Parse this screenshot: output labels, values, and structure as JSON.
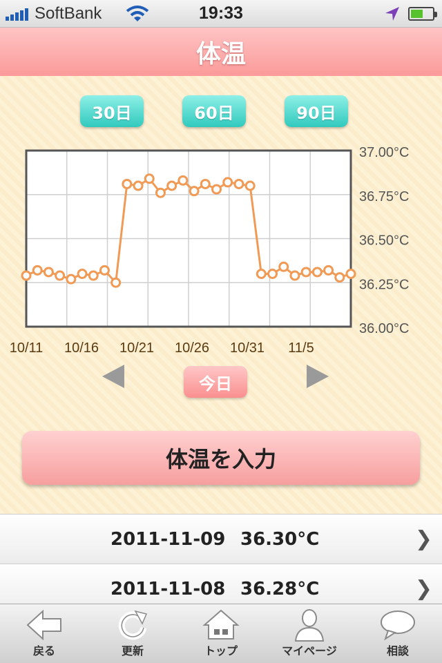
{
  "status_bar": {
    "carrier": "SoftBank",
    "time": "19:33"
  },
  "nav": {
    "title": "体温"
  },
  "ranges": [
    {
      "label": "30日"
    },
    {
      "label": "60日"
    },
    {
      "label": "90日"
    }
  ],
  "chart_data": {
    "type": "line",
    "ylim": [
      36.0,
      37.0
    ],
    "yticks": [
      "37.00°C",
      "36.75°C",
      "36.50°C",
      "36.25°C",
      "36.00°C"
    ],
    "xticks": [
      "10/11",
      "10/16",
      "10/21",
      "10/26",
      "10/31",
      "11/5"
    ],
    "x": [
      "10/11",
      "10/12",
      "10/13",
      "10/14",
      "10/15",
      "10/16",
      "10/17",
      "10/18",
      "10/19",
      "10/20",
      "10/21",
      "10/22",
      "10/23",
      "10/24",
      "10/25",
      "10/26",
      "10/27",
      "10/28",
      "10/29",
      "10/30",
      "10/31",
      "11/1",
      "11/2",
      "11/3",
      "11/4",
      "11/5",
      "11/6",
      "11/7",
      "11/8",
      "11/9"
    ],
    "series": [
      {
        "values": [
          36.29,
          36.32,
          36.31,
          36.29,
          36.27,
          36.3,
          36.29,
          36.32,
          36.25,
          36.81,
          36.8,
          36.84,
          36.76,
          36.8,
          36.83,
          36.77,
          36.81,
          36.78,
          36.82,
          36.81,
          36.8,
          36.3,
          36.3,
          36.34,
          36.29,
          36.31,
          36.31,
          36.32,
          36.28,
          36.3
        ]
      }
    ],
    "color": "#f09a55",
    "grid": true
  },
  "today_label": "今日",
  "input_button": "体温を入力",
  "records": [
    {
      "date": "2011-11-09",
      "temp": "36.30°C"
    },
    {
      "date": "2011-11-08",
      "temp": "36.28°C"
    }
  ],
  "tabs": [
    {
      "label": "戻る",
      "icon": "back-arrow-icon"
    },
    {
      "label": "更新",
      "icon": "refresh-icon"
    },
    {
      "label": "トップ",
      "icon": "home-icon"
    },
    {
      "label": "マイページ",
      "icon": "person-icon"
    },
    {
      "label": "相談",
      "icon": "speech-bubble-icon"
    }
  ]
}
